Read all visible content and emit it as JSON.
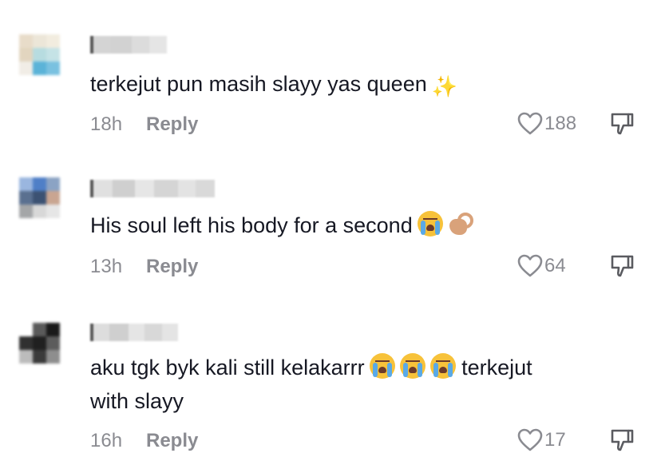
{
  "comments": [
    {
      "text": "terkejut pun masih slayy yas queen",
      "emoji_after": "✨",
      "time": "18h",
      "reply_label": "Reply",
      "likes": "188",
      "avatar_colors": [
        "#e8dcc9",
        "#ece6d8",
        "#f2ecdf",
        "#ffffff",
        "#e2d5bf",
        "#b7dce0",
        "#c5e3e6",
        "#ffffff",
        "#f1ede6",
        "#5bb3d8",
        "#79c1e0",
        "#ffffff",
        "#ffffff",
        "#ffffff",
        "#ffffff",
        "#ffffff"
      ],
      "username_colors": [
        "#ffffff",
        "#d4d4d4",
        "#d2d2d2",
        "#dcdcdc",
        "#e5e5e5"
      ]
    },
    {
      "text": "His soul left his body for a second",
      "time": "13h",
      "reply_label": "Reply",
      "likes": "64",
      "avatar_colors": [
        "#9ab6df",
        "#4f7fc7",
        "#8ba3c4",
        "#ffffff",
        "#5a7090",
        "#3c5273",
        "#c9a591",
        "#ffffff",
        "#a4a6a8",
        "#d8d8d8",
        "#e6e6e6",
        "#ffffff",
        "#ffffff",
        "#ffffff",
        "#ffffff",
        "#ffffff"
      ],
      "username_colors": [
        "#ffffff",
        "#e0e0e0",
        "#cfcfcf",
        "#e6e6e6",
        "#d5d5d5",
        "#e3e3e3",
        "#d9d9d9"
      ]
    },
    {
      "text_line1": "aku tgk byk kali still kelakarrr",
      "text_line1_suffix": "terkejut",
      "text_line2": "with slayy",
      "time": "16h",
      "reply_label": "Reply",
      "likes": "17",
      "avatar_colors": [
        "#ffffff",
        "#5a5a5a",
        "#1a1a1a",
        "#ffffff",
        "#303030",
        "#202020",
        "#5c5c5c",
        "#ffffff",
        "#bcbcbc",
        "#3a3a3a",
        "#8e8e8e",
        "#ffffff",
        "#ffffff",
        "#ffffff",
        "#ffffff",
        "#ffffff"
      ],
      "username_colors": [
        "#ffffff",
        "#dddddd",
        "#cfcfcf",
        "#e5e5e5",
        "#d8d8d8",
        "#e4e4e4"
      ]
    }
  ],
  "icons": {
    "like": "heart-outline-icon",
    "dislike": "thumbs-down-outline-icon"
  },
  "colors": {
    "text": "#161823",
    "secondary": "#8a8b91"
  }
}
